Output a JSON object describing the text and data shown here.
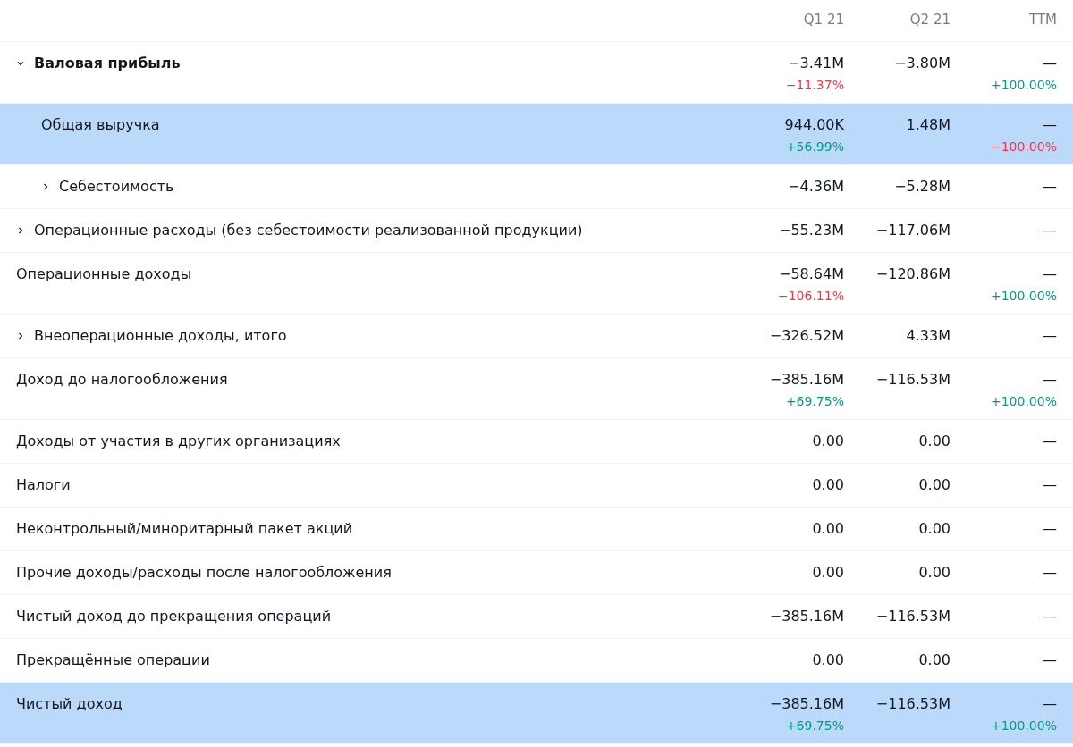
{
  "table": {
    "columns": [
      "Q1 21",
      "Q2 21",
      "TTM"
    ],
    "rows": [
      {
        "label": "Валовая прибыль",
        "kind": "group",
        "expanded": true,
        "selected": false,
        "cells": [
          {
            "value": "−3.41M",
            "change": {
              "text": "−11.37%",
              "color": "#f23645"
            }
          },
          {
            "value": "−3.80M"
          },
          {
            "value": "—",
            "change": {
              "text": "+100.00%",
              "color": "#089981"
            }
          }
        ],
        "children": [
          {
            "label": "Общая выручка",
            "kind": "line",
            "selected": true,
            "cells": [
              {
                "value": "944.00K",
                "change": {
                  "text": "+56.99%",
                  "color": "#089981"
                }
              },
              {
                "value": "1.48M"
              },
              {
                "value": "—",
                "change": {
                  "text": "−100.00%",
                  "color": "#f23645"
                }
              }
            ]
          },
          {
            "label": "Себестоимость",
            "kind": "group",
            "expanded": false,
            "selected": false,
            "cells": [
              {
                "value": "−4.36M"
              },
              {
                "value": "−5.28M"
              },
              {
                "value": "—"
              }
            ]
          }
        ]
      },
      {
        "label": "Операционные расходы (без себестоимости реализованной продукции)",
        "kind": "group",
        "expanded": false,
        "selected": false,
        "cells": [
          {
            "value": "−55.23M"
          },
          {
            "value": "−117.06M"
          },
          {
            "value": "—"
          }
        ]
      },
      {
        "label": "Операционные доходы",
        "kind": "line",
        "selected": false,
        "cells": [
          {
            "value": "−58.64M",
            "change": {
              "text": "−106.11%",
              "color": "#f23645"
            }
          },
          {
            "value": "−120.86M"
          },
          {
            "value": "—",
            "change": {
              "text": "+100.00%",
              "color": "#089981"
            }
          }
        ]
      },
      {
        "label": "Внеоперационные доходы, итого",
        "kind": "group",
        "expanded": false,
        "selected": false,
        "cells": [
          {
            "value": "−326.52M"
          },
          {
            "value": "4.33M"
          },
          {
            "value": "—"
          }
        ]
      },
      {
        "label": "Доход до налогообложения",
        "kind": "line",
        "selected": false,
        "cells": [
          {
            "value": "−385.16M",
            "change": {
              "text": "+69.75%",
              "color": "#089981"
            }
          },
          {
            "value": "−116.53M"
          },
          {
            "value": "—",
            "change": {
              "text": "+100.00%",
              "color": "#089981"
            }
          }
        ]
      },
      {
        "label": "Доходы от участия в других организациях",
        "kind": "line",
        "selected": false,
        "cells": [
          {
            "value": "0.00"
          },
          {
            "value": "0.00"
          },
          {
            "value": "—"
          }
        ]
      },
      {
        "label": "Налоги",
        "kind": "line",
        "selected": false,
        "cells": [
          {
            "value": "0.00"
          },
          {
            "value": "0.00"
          },
          {
            "value": "—"
          }
        ]
      },
      {
        "label": "Неконтрольный/миноритарный пакет акций",
        "kind": "line",
        "selected": false,
        "cells": [
          {
            "value": "0.00"
          },
          {
            "value": "0.00"
          },
          {
            "value": "—"
          }
        ]
      },
      {
        "label": "Прочие доходы/расходы после налогообложения",
        "kind": "line",
        "selected": false,
        "cells": [
          {
            "value": "0.00"
          },
          {
            "value": "0.00"
          },
          {
            "value": "—"
          }
        ]
      },
      {
        "label": "Чистый доход до прекращения операций",
        "kind": "line",
        "selected": false,
        "cells": [
          {
            "value": "−385.16M"
          },
          {
            "value": "−116.53M"
          },
          {
            "value": "—"
          }
        ]
      },
      {
        "label": "Прекращённые операции",
        "kind": "line",
        "selected": false,
        "cells": [
          {
            "value": "0.00"
          },
          {
            "value": "0.00"
          },
          {
            "value": "—"
          }
        ]
      },
      {
        "label": "Чистый доход",
        "kind": "line",
        "selected": true,
        "cells": [
          {
            "value": "−385.16M",
            "change": {
              "text": "+69.75%",
              "color": "#089981"
            }
          },
          {
            "value": "−116.53M"
          },
          {
            "value": "—",
            "change": {
              "text": "+100.00%",
              "color": "#089981"
            }
          }
        ]
      }
    ]
  }
}
